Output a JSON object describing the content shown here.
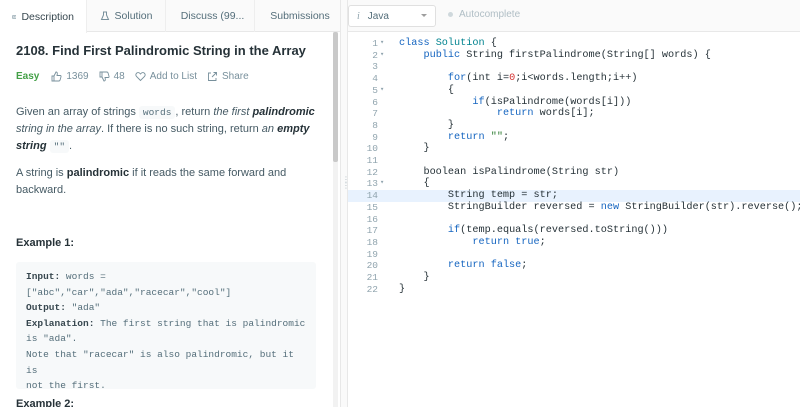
{
  "tabs": [
    {
      "label": "Description",
      "icon": "description-icon"
    },
    {
      "label": "Solution",
      "icon": "flask-icon"
    },
    {
      "label": "Discuss (99...",
      "icon": "discuss-icon"
    },
    {
      "label": "Submissions",
      "icon": "clock-icon"
    }
  ],
  "problem": {
    "title": "2108. Find First Palindromic String in the Array",
    "difficulty": "Easy",
    "likes": "1369",
    "dislikes": "48",
    "add_to_list": "Add to List",
    "share": "Share",
    "desc1": {
      "t1": "Given an array of strings ",
      "code1": "words",
      "t2": ", return ",
      "it1": "the first ",
      "bi1": "palindromic",
      "it2": " string in the array",
      "t3": ". If there is no such string, return ",
      "it3": "an ",
      "bi2": "empty string",
      "code2": "\"\"",
      "t4": "."
    },
    "desc2": {
      "t1": "A string is ",
      "b1": "palindromic",
      "t2": " if it reads the same forward and backward."
    },
    "example1_title": "Example 1:",
    "example1": {
      "input_label": "Input:",
      "input_val1": " words =",
      "input_val2": "[\"abc\",\"car\",\"ada\",\"racecar\",\"cool\"]",
      "output_label": "Output:",
      "output_val": " \"ada\"",
      "expl_label": "Explanation:",
      "expl_val1": " The first string that is palindromic",
      "expl_val2": "is \"ada\".",
      "expl_val3": "Note that \"racecar\" is also palindromic, but it is",
      "expl_val4": "not the first."
    },
    "example2_title": "Example 2:"
  },
  "editor": {
    "language": "Java",
    "autocomplete": "Autocomplete",
    "active_line": 14,
    "lines": [
      {
        "n": "1",
        "fold": true,
        "code": [
          [
            "kw",
            "class "
          ],
          [
            "cls",
            "Solution "
          ],
          [
            "",
            "{"
          ]
        ]
      },
      {
        "n": "2",
        "fold": true,
        "code": [
          [
            "",
            "    "
          ],
          [
            "kw",
            "public "
          ],
          [
            "",
            "String firstPalindrome(String[] words) {"
          ]
        ]
      },
      {
        "n": "3",
        "fold": false,
        "code": []
      },
      {
        "n": "4",
        "fold": false,
        "code": [
          [
            "",
            "        "
          ],
          [
            "kw",
            "for"
          ],
          [
            "",
            "(int i="
          ],
          [
            "num",
            "0"
          ],
          [
            "",
            ";i<words.length;i++)"
          ]
        ]
      },
      {
        "n": "5",
        "fold": true,
        "code": [
          [
            "",
            "        {"
          ]
        ]
      },
      {
        "n": "6",
        "fold": false,
        "code": [
          [
            "",
            "            "
          ],
          [
            "kw",
            "if"
          ],
          [
            "",
            "(isPalindrome(words[i]))"
          ]
        ]
      },
      {
        "n": "7",
        "fold": false,
        "code": [
          [
            "",
            "                "
          ],
          [
            "kw",
            "return "
          ],
          [
            "",
            "words[i];"
          ]
        ]
      },
      {
        "n": "8",
        "fold": false,
        "code": [
          [
            "",
            "        }"
          ]
        ]
      },
      {
        "n": "9",
        "fold": false,
        "code": [
          [
            "",
            "        "
          ],
          [
            "kw",
            "return "
          ],
          [
            "str",
            "\"\""
          ],
          [
            "",
            ";"
          ]
        ]
      },
      {
        "n": "10",
        "fold": false,
        "code": [
          [
            "",
            "    }"
          ]
        ]
      },
      {
        "n": "11",
        "fold": false,
        "code": []
      },
      {
        "n": "12",
        "fold": false,
        "code": [
          [
            "",
            "    boolean isPalindrome(String str)"
          ]
        ]
      },
      {
        "n": "13",
        "fold": true,
        "code": [
          [
            "",
            "    {"
          ]
        ]
      },
      {
        "n": "14",
        "fold": false,
        "code": [
          [
            "",
            "        String temp = str;"
          ]
        ]
      },
      {
        "n": "15",
        "fold": false,
        "code": [
          [
            "",
            "        StringBuilder reversed = "
          ],
          [
            "kw",
            "new "
          ],
          [
            "",
            "StringBuilder(str).reverse();"
          ]
        ]
      },
      {
        "n": "16",
        "fold": false,
        "code": []
      },
      {
        "n": "17",
        "fold": false,
        "code": [
          [
            "",
            "        "
          ],
          [
            "kw",
            "if"
          ],
          [
            "",
            "(temp.equals(reversed.toString()))"
          ]
        ]
      },
      {
        "n": "18",
        "fold": false,
        "code": [
          [
            "",
            "            "
          ],
          [
            "kw",
            "return "
          ],
          [
            "kw",
            "true"
          ],
          [
            "",
            ";"
          ]
        ]
      },
      {
        "n": "19",
        "fold": false,
        "code": []
      },
      {
        "n": "20",
        "fold": false,
        "code": [
          [
            "",
            "        "
          ],
          [
            "kw",
            "return "
          ],
          [
            "kw",
            "false"
          ],
          [
            "",
            ";"
          ]
        ]
      },
      {
        "n": "21",
        "fold": false,
        "code": [
          [
            "",
            "    }"
          ]
        ]
      },
      {
        "n": "22",
        "fold": false,
        "code": [
          [
            "",
            "}"
          ]
        ]
      }
    ]
  }
}
